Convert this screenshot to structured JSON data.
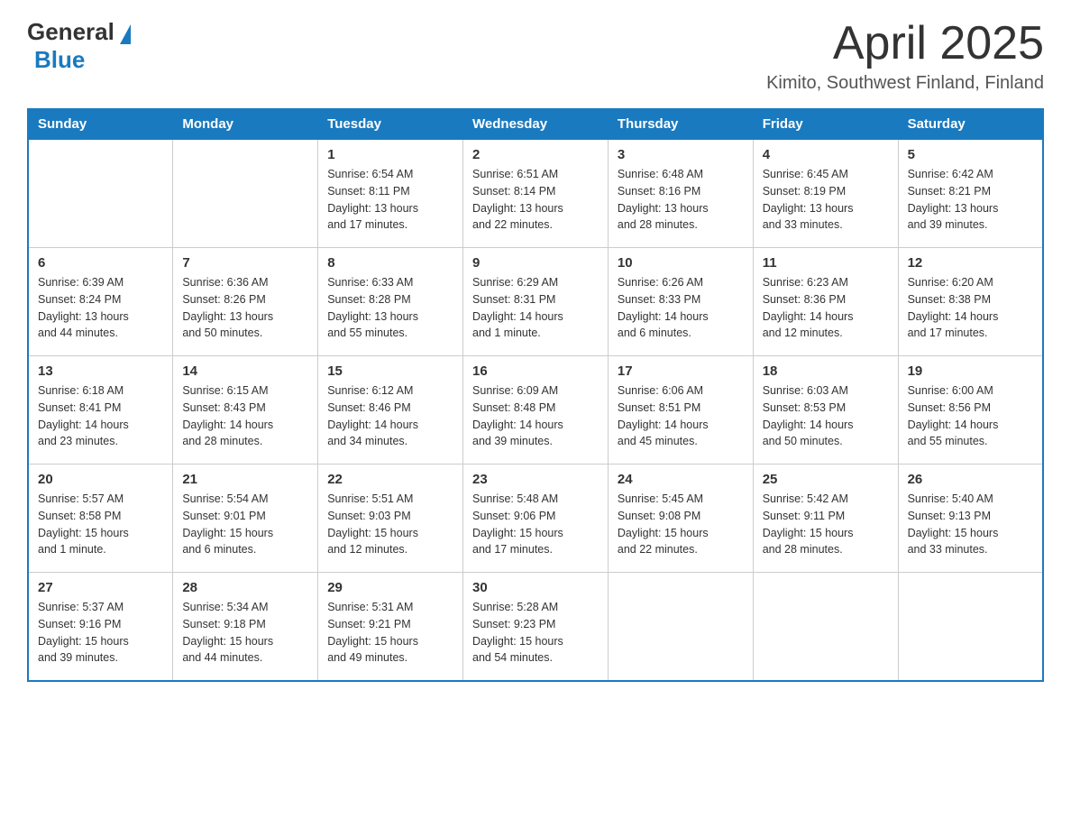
{
  "header": {
    "logo_general": "General",
    "logo_blue": "Blue",
    "month_title": "April 2025",
    "location": "Kimito, Southwest Finland, Finland"
  },
  "weekdays": [
    "Sunday",
    "Monday",
    "Tuesday",
    "Wednesday",
    "Thursday",
    "Friday",
    "Saturday"
  ],
  "weeks": [
    [
      {
        "day": "",
        "info": ""
      },
      {
        "day": "",
        "info": ""
      },
      {
        "day": "1",
        "info": "Sunrise: 6:54 AM\nSunset: 8:11 PM\nDaylight: 13 hours\nand 17 minutes."
      },
      {
        "day": "2",
        "info": "Sunrise: 6:51 AM\nSunset: 8:14 PM\nDaylight: 13 hours\nand 22 minutes."
      },
      {
        "day": "3",
        "info": "Sunrise: 6:48 AM\nSunset: 8:16 PM\nDaylight: 13 hours\nand 28 minutes."
      },
      {
        "day": "4",
        "info": "Sunrise: 6:45 AM\nSunset: 8:19 PM\nDaylight: 13 hours\nand 33 minutes."
      },
      {
        "day": "5",
        "info": "Sunrise: 6:42 AM\nSunset: 8:21 PM\nDaylight: 13 hours\nand 39 minutes."
      }
    ],
    [
      {
        "day": "6",
        "info": "Sunrise: 6:39 AM\nSunset: 8:24 PM\nDaylight: 13 hours\nand 44 minutes."
      },
      {
        "day": "7",
        "info": "Sunrise: 6:36 AM\nSunset: 8:26 PM\nDaylight: 13 hours\nand 50 minutes."
      },
      {
        "day": "8",
        "info": "Sunrise: 6:33 AM\nSunset: 8:28 PM\nDaylight: 13 hours\nand 55 minutes."
      },
      {
        "day": "9",
        "info": "Sunrise: 6:29 AM\nSunset: 8:31 PM\nDaylight: 14 hours\nand 1 minute."
      },
      {
        "day": "10",
        "info": "Sunrise: 6:26 AM\nSunset: 8:33 PM\nDaylight: 14 hours\nand 6 minutes."
      },
      {
        "day": "11",
        "info": "Sunrise: 6:23 AM\nSunset: 8:36 PM\nDaylight: 14 hours\nand 12 minutes."
      },
      {
        "day": "12",
        "info": "Sunrise: 6:20 AM\nSunset: 8:38 PM\nDaylight: 14 hours\nand 17 minutes."
      }
    ],
    [
      {
        "day": "13",
        "info": "Sunrise: 6:18 AM\nSunset: 8:41 PM\nDaylight: 14 hours\nand 23 minutes."
      },
      {
        "day": "14",
        "info": "Sunrise: 6:15 AM\nSunset: 8:43 PM\nDaylight: 14 hours\nand 28 minutes."
      },
      {
        "day": "15",
        "info": "Sunrise: 6:12 AM\nSunset: 8:46 PM\nDaylight: 14 hours\nand 34 minutes."
      },
      {
        "day": "16",
        "info": "Sunrise: 6:09 AM\nSunset: 8:48 PM\nDaylight: 14 hours\nand 39 minutes."
      },
      {
        "day": "17",
        "info": "Sunrise: 6:06 AM\nSunset: 8:51 PM\nDaylight: 14 hours\nand 45 minutes."
      },
      {
        "day": "18",
        "info": "Sunrise: 6:03 AM\nSunset: 8:53 PM\nDaylight: 14 hours\nand 50 minutes."
      },
      {
        "day": "19",
        "info": "Sunrise: 6:00 AM\nSunset: 8:56 PM\nDaylight: 14 hours\nand 55 minutes."
      }
    ],
    [
      {
        "day": "20",
        "info": "Sunrise: 5:57 AM\nSunset: 8:58 PM\nDaylight: 15 hours\nand 1 minute."
      },
      {
        "day": "21",
        "info": "Sunrise: 5:54 AM\nSunset: 9:01 PM\nDaylight: 15 hours\nand 6 minutes."
      },
      {
        "day": "22",
        "info": "Sunrise: 5:51 AM\nSunset: 9:03 PM\nDaylight: 15 hours\nand 12 minutes."
      },
      {
        "day": "23",
        "info": "Sunrise: 5:48 AM\nSunset: 9:06 PM\nDaylight: 15 hours\nand 17 minutes."
      },
      {
        "day": "24",
        "info": "Sunrise: 5:45 AM\nSunset: 9:08 PM\nDaylight: 15 hours\nand 22 minutes."
      },
      {
        "day": "25",
        "info": "Sunrise: 5:42 AM\nSunset: 9:11 PM\nDaylight: 15 hours\nand 28 minutes."
      },
      {
        "day": "26",
        "info": "Sunrise: 5:40 AM\nSunset: 9:13 PM\nDaylight: 15 hours\nand 33 minutes."
      }
    ],
    [
      {
        "day": "27",
        "info": "Sunrise: 5:37 AM\nSunset: 9:16 PM\nDaylight: 15 hours\nand 39 minutes."
      },
      {
        "day": "28",
        "info": "Sunrise: 5:34 AM\nSunset: 9:18 PM\nDaylight: 15 hours\nand 44 minutes."
      },
      {
        "day": "29",
        "info": "Sunrise: 5:31 AM\nSunset: 9:21 PM\nDaylight: 15 hours\nand 49 minutes."
      },
      {
        "day": "30",
        "info": "Sunrise: 5:28 AM\nSunset: 9:23 PM\nDaylight: 15 hours\nand 54 minutes."
      },
      {
        "day": "",
        "info": ""
      },
      {
        "day": "",
        "info": ""
      },
      {
        "day": "",
        "info": ""
      }
    ]
  ]
}
